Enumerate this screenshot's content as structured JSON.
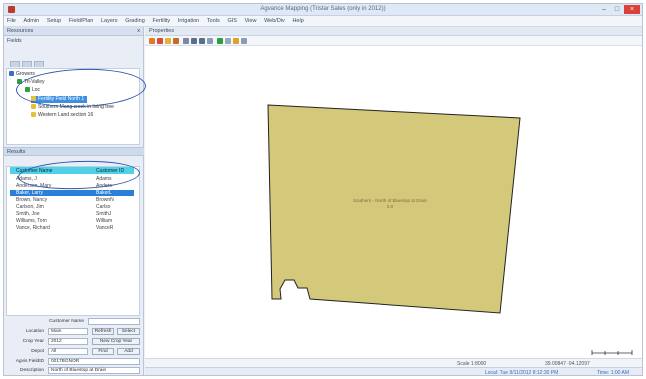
{
  "window": {
    "title": "Agvance Mapping (Tristar Sales (only in 2012))",
    "close_glyph": "×",
    "max_glyph": "□",
    "min_glyph": "–"
  },
  "menu": [
    "File",
    "Admin",
    "Setup",
    "Field/Plan",
    "Layers",
    "Grading",
    "Fertility",
    "Irrigation",
    "Tools",
    "GIS",
    "View",
    "Web/Div",
    "Help"
  ],
  "left_panel": {
    "header": "Resources",
    "close_glyph": "x",
    "subheader": "Fields",
    "tree": [
      {
        "label": "Growers",
        "icon_color": "#3b6fc6"
      },
      {
        "label": "Tri-Valley",
        "icon_color": "#2e9e3f"
      },
      {
        "label": "Loc",
        "icon_color": "#2e9e3f"
      },
      {
        "label": "Fertility Field  North 1",
        "icon_color": "#e8c13a"
      },
      {
        "label": "Southern  Mang creek in living tree",
        "icon_color": "#e8c13a"
      },
      {
        "label": "Western  Land section 16",
        "icon_color": "#e8c13a"
      }
    ],
    "results_header": "Results",
    "grid_columns": [
      "Customer Name",
      "Customer ID"
    ],
    "grid_rows": [
      [
        "Adams, J",
        "Adams"
      ],
      [
        "Anderson, Mary",
        "Anders"
      ],
      [
        "Baker, Larry",
        "BakerL"
      ],
      [
        "Brown, Nancy",
        "BrownN"
      ],
      [
        "Carlson, Jim",
        "Carlso"
      ],
      [
        "Smith, Joe",
        "SmithJ"
      ],
      [
        "Williams, Tom",
        "William"
      ],
      [
        "Vance, Richard",
        "VanceR"
      ]
    ],
    "form": {
      "customer_name_label": "Customer Name",
      "customer_name_value": "",
      "location_label": "Location",
      "location_value": "Main",
      "refresh_label": "Refresh",
      "select_label": "Select",
      "crop_year_label": "Crop Year",
      "crop_year_value": "2012",
      "new_crop_year_label": "New Crop Year",
      "depot_label": "Depot",
      "depot_value": "All",
      "find_label": "Find",
      "add_label": "Add",
      "field_id_label": "Agvis FieldID",
      "field_id_value": "0017BGNOR",
      "description_label": "Description",
      "description_value": "North of Bluestop at Drain"
    }
  },
  "map": {
    "doc_tab": "Properties",
    "polygon_color": "#d4c87a",
    "polygon_label_1": "Southern - North of Bluestop at Drain",
    "polygon_label_2": "0.0",
    "status_scale": "Scale 1:8000",
    "status_coords": "39.00847 -94.12097",
    "status_link": "Local: Tue 9/11/2012 8:12:30 PM",
    "status_time": "Time: 1:00 AM"
  },
  "colors": {
    "selection": "#2c7fd6",
    "header_cyan": "#4fd1e8",
    "annotation_ellipse": "#2f56b0"
  }
}
